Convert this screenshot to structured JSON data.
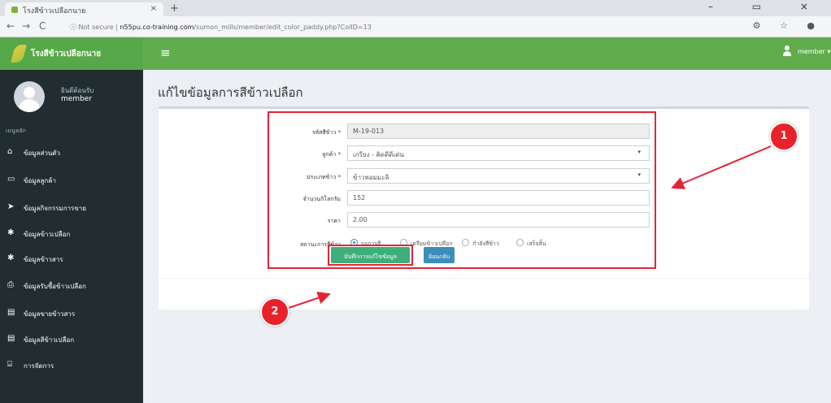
{
  "browser": {
    "tab_title": "โรงสีข้าวเปลือกนาย",
    "tab_close": "×",
    "new_tab": "+",
    "window_controls": "– ▭ ×",
    "back": "←",
    "forward": "→",
    "reload": "C",
    "security": "ⓘ Not secure",
    "url_host": "n55pu.co-training.com",
    "url_path": "/sumon_mills/member/edit_color_paddy.php?ColID=13",
    "addr_icons": "⚙ ☆ ●"
  },
  "sidebar": {
    "brand": "โรงสีข้าวเปลือกนาย",
    "user_name": "ยินดีต้อนรับ",
    "user_role": "member",
    "menu_header": "เมนูหลัก",
    "items": [
      {
        "icon": "home-icon",
        "glyph": "⌂",
        "label": "ข้อมูลส่วนตัว"
      },
      {
        "icon": "monitor-icon",
        "glyph": "▭",
        "label": "ข้อมูลลูกค้า"
      },
      {
        "icon": "send-icon",
        "glyph": "➤",
        "label": "ข้อมูลกิจกรรมการขาย"
      },
      {
        "icon": "pin-icon",
        "glyph": "✱",
        "label": "ข้อมูลข้าวเปลือก"
      },
      {
        "icon": "pin-icon-2",
        "glyph": "✱",
        "label": "ข้อมูลข้าวสาร"
      },
      {
        "icon": "print-icon",
        "glyph": "⎙",
        "label": "ข้อมูลรับซื้อข้าวเปลือก"
      },
      {
        "icon": "table-icon",
        "glyph": "▤",
        "label": "ข้อมูลขายข้าวสาร"
      },
      {
        "icon": "table-icon-2",
        "glyph": "▤",
        "label": "ข้อมูลสีข้าวเปลือก"
      },
      {
        "icon": "bank-icon",
        "glyph": "⌸",
        "label": "การจัดการ"
      }
    ]
  },
  "navbar": {
    "hamburger": "≡",
    "user_label": "member ▾"
  },
  "page": {
    "title": "แก้ไขข้อมูลการสีข้าวเปลือก"
  },
  "form": {
    "fields": [
      {
        "label": "รหัสสีข้าว *",
        "value": "M-19-013",
        "type": "readonly"
      },
      {
        "label": "ลูกค้า *",
        "value": "เกรียง - คิดดีดีเด่น",
        "type": "select"
      },
      {
        "label": "ประเภทข้าว *",
        "value": "ข้าวหอมมะลิ",
        "type": "select"
      },
      {
        "label": "จำนวนกิโลกรัม",
        "value": "152",
        "type": "text"
      },
      {
        "label": "ราคา",
        "value": "2.00",
        "type": "text"
      }
    ],
    "status_label": "สถานะการสีข้าว",
    "status_options": [
      "รอการสี",
      "เตรียมข้าวเปลือก",
      "กำลังสีข้าว",
      "เสร็จสิ้น"
    ],
    "status_selected": 0,
    "save_label": "บันทึกการแก้ไขข้อมูล",
    "back_label": "ย้อนกลับ"
  },
  "annotations": {
    "callout_1": "1",
    "callout_2": "2",
    "color": "#e32531"
  }
}
